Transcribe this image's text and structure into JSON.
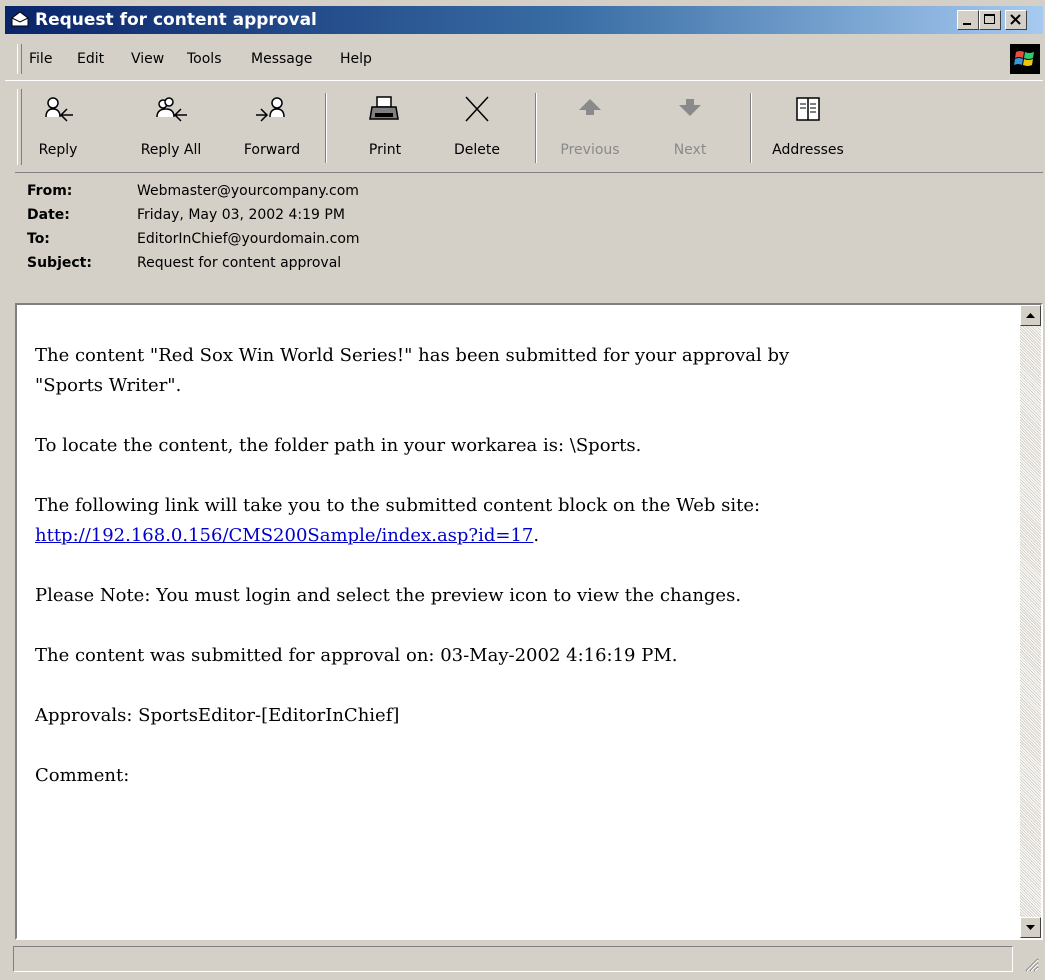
{
  "window": {
    "title": "Request for content approval"
  },
  "menu": {
    "items": [
      "File",
      "Edit",
      "View",
      "Tools",
      "Message",
      "Help"
    ]
  },
  "toolbar": {
    "buttons": [
      {
        "label": "Reply",
        "icon": "reply-icon",
        "enabled": true
      },
      {
        "label": "Reply All",
        "icon": "reply-all-icon",
        "enabled": true
      },
      {
        "label": "Forward",
        "icon": "forward-icon",
        "enabled": true
      },
      {
        "label": "Print",
        "icon": "printer-icon",
        "enabled": true
      },
      {
        "label": "Delete",
        "icon": "delete-x-icon",
        "enabled": true
      },
      {
        "label": "Previous",
        "icon": "up-arrow-icon",
        "enabled": false
      },
      {
        "label": "Next",
        "icon": "down-arrow-icon",
        "enabled": false
      },
      {
        "label": "Addresses",
        "icon": "address-book-icon",
        "enabled": true
      }
    ]
  },
  "header": {
    "from_label": "From:",
    "from": "Webmaster@yourcompany.com",
    "date_label": "Date:",
    "date": "Friday, May 03, 2002 4:19 PM",
    "to_label": "To:",
    "to": "EditorInChief@yourdomain.com",
    "subject_label": "Subject:",
    "subject": "Request for content approval"
  },
  "body": {
    "p1": "The content \"Red Sox Win World Series!\" has been submitted for your approval by \"Sports Writer\".",
    "p2": "To locate the content, the folder path in your workarea is: \\Sports.",
    "p3_prefix": "The following link will take you to the submitted content block on the Web site: ",
    "p3_link": "http://192.168.0.156/CMS200Sample/index.asp?id=17",
    "p3_suffix": ".",
    "p4": "Please Note: You must login and select the preview icon to view the changes.",
    "p5": "The content was submitted for approval on: 03-May-2002 4:16:19 PM.",
    "p6": "Approvals: SportsEditor-[EditorInChief]",
    "p7": "Comment:"
  },
  "colors": {
    "title_bar_start": "#0a246a",
    "title_bar_end": "#a6caf0",
    "chrome": "#d4d0c8",
    "link": "#0000cc"
  }
}
